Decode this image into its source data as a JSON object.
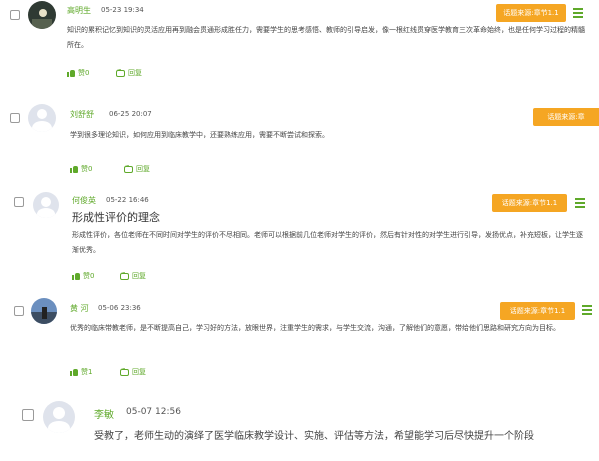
{
  "comments": [
    {
      "name": "高明生",
      "time": "05-23 19:34",
      "badge": "话题来源:章节1.1",
      "text": "知识的累积记忆到知识的灵活应用再到融会贯通形成胜任力，需要学生的思考感悟、教师的引导启发，像一根红线贯穿医学教育三次革命始终，也是任何学习过程的精髓所在。",
      "like": "赞0",
      "reply": "回复"
    },
    {
      "name": "刘舒舒",
      "time": "06-25 20:07",
      "badge": "话题来源:章",
      "text": "学到很多理论知识，如何应用到临床教学中，还要熟练应用，需要不断尝试和探索。",
      "like": "赞0",
      "reply": "回复"
    },
    {
      "name": "何俊英",
      "time": "05-22 16:46",
      "badge": "话题来源:章节1.1",
      "title": "形成性评价的理念",
      "text": "形成性评价，各位老师在不同时间对学生的评价不尽相同。老师可以根据前几位老师对学生的评价，然后有针对性的对学生进行引导，发扬优点，补充短板，让学生逐渐优秀。",
      "like": "赞0",
      "reply": "回复"
    },
    {
      "name": "黄 河",
      "time": "05-06 23:36",
      "badge": "话题来源:章节1.1",
      "text": "优秀的临床带教老师，是不断提高自己，学习好的方法，放眼世界，注重学生的需求，与学生交流，沟通，了解他们的意愿，带给他们思路和研究方向为目标。",
      "like": "赞1",
      "reply": "回复"
    },
    {
      "name": "李敏",
      "time": "05-07 12:56",
      "text": "受教了，老师生动的演绎了医学临床教学设计、实施、评估等方法，希望能学习后尽快提升一个阶段"
    }
  ]
}
